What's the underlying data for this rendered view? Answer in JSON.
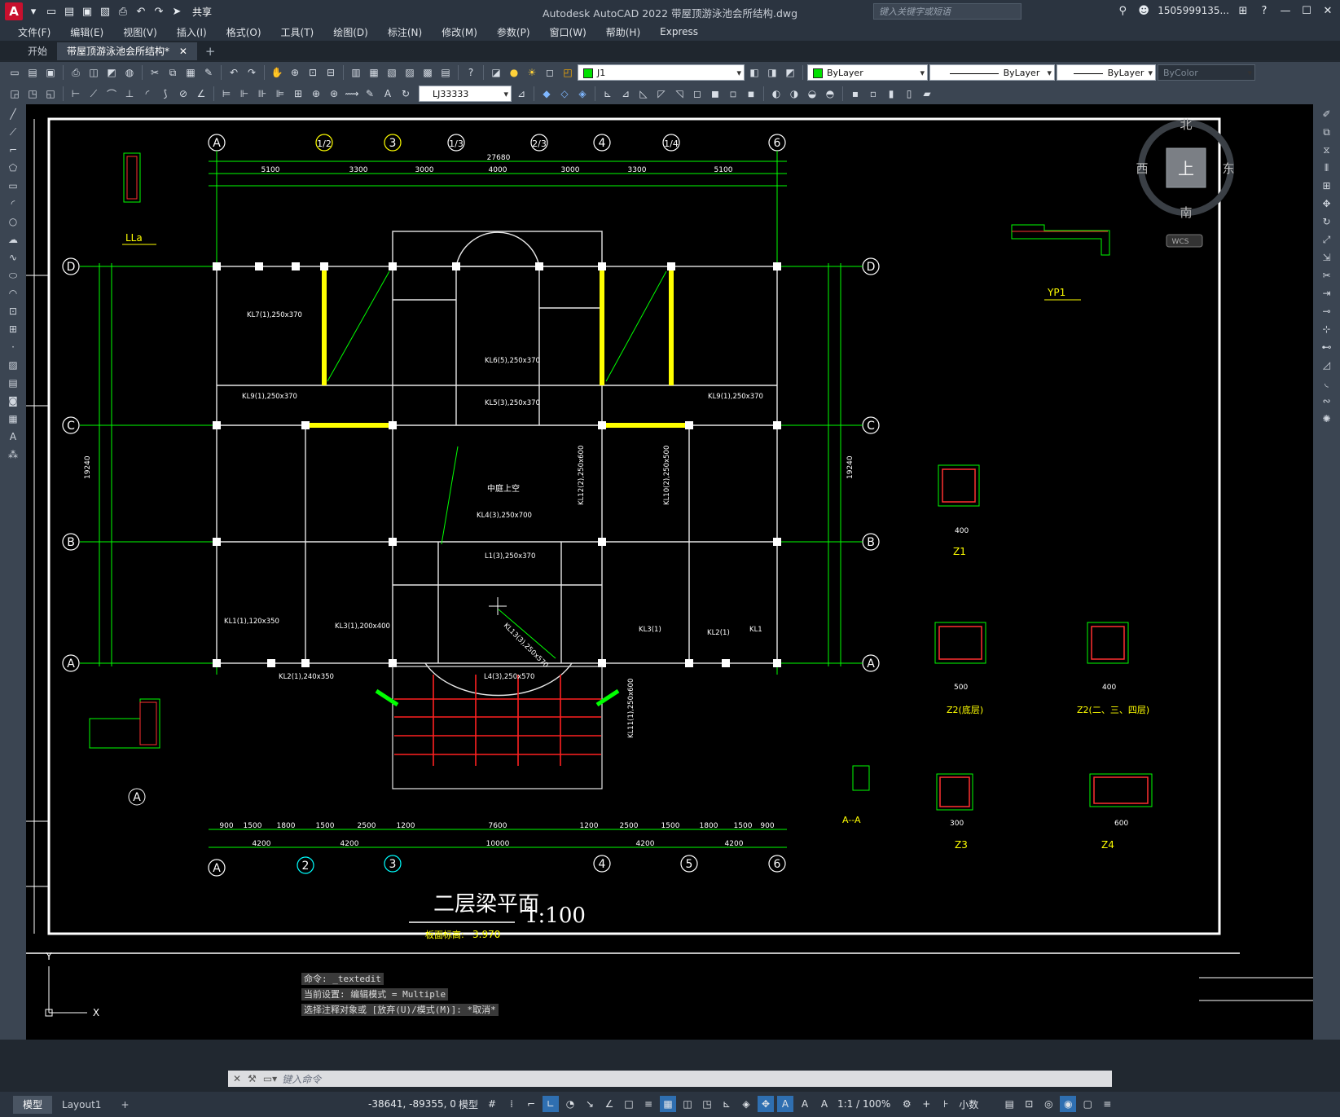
{
  "app": {
    "title": "Autodesk AutoCAD 2022    带屋顶游泳池会所结构.dwg",
    "share_label": "共享",
    "search_placeholder": "键入关键字或短语",
    "user": "1505999135...",
    "logo": "A"
  },
  "menu": [
    "文件(F)",
    "编辑(E)",
    "视图(V)",
    "插入(I)",
    "格式(O)",
    "工具(T)",
    "绘图(D)",
    "标注(N)",
    "修改(M)",
    "参数(P)",
    "窗口(W)",
    "帮助(H)",
    "Express"
  ],
  "tabs": [
    {
      "label": "开始",
      "active": false
    },
    {
      "label": "带屋顶游泳池会所结构*",
      "active": true
    }
  ],
  "toolbar": {
    "layer": "J1",
    "color": "ByLayer",
    "linetype": "ByLayer",
    "lineweight": "ByLayer",
    "plotstyle": "ByColor",
    "dimstyle": "LJ33333"
  },
  "viewcube": {
    "north": "北",
    "south": "南",
    "east": "东",
    "west": "西",
    "face": "上",
    "wcs": "WCS"
  },
  "drawing": {
    "title": "二层梁平面",
    "scale": "1:100",
    "note_label": "板面标高:",
    "note_value": "3.970",
    "total_width": "27680",
    "total_depth": "19240",
    "center_label": "中庭上空",
    "top_dims": [
      "5100",
      "3300",
      "3000",
      "4000",
      "3000",
      "3300",
      "5100"
    ],
    "top_axes": [
      "A",
      "1/2",
      "3",
      "1/3",
      "2/3",
      "4",
      "1/4",
      "6"
    ],
    "bottom_axes": [
      "A",
      "2",
      "3",
      "4",
      "5",
      "6"
    ],
    "side_axes": [
      "D",
      "C",
      "B",
      "A"
    ],
    "bottom_dims": [
      "4200",
      "4200",
      "10000",
      "4200",
      "4200"
    ],
    "bottom_dims2": [
      "900",
      "1500",
      "1800",
      "1500",
      "2500",
      "1200",
      "7600",
      "1200",
      "2500",
      "1500",
      "1800",
      "1500",
      "900"
    ],
    "beam_labels": [
      "KL7(1),250x370",
      "KL9(1),250x370",
      "KL6(5),250x370",
      "KL5(3),250x370",
      "KL4(3),250x700",
      "KL1(1),120x350",
      "KL3(1),200x400",
      "KL2(1),240x350",
      "L4(3),250x570",
      "L1(3),250x370",
      "KL13(3),250x570",
      "KL9(1),250x370",
      "KL3(1)",
      "KL2(1)",
      "KL1",
      "KL10(2),250x500",
      "KL12(2),250x600",
      "KL11(1),250x600"
    ],
    "details": [
      {
        "name": "LLa"
      },
      {
        "name": "YP1"
      },
      {
        "name": "Z1",
        "w": "400",
        "h": "400"
      },
      {
        "name": "Z2(底层)",
        "w": "500",
        "h": "400"
      },
      {
        "name": "Z2(二、三、四层)",
        "w": "400",
        "h": "400"
      },
      {
        "name": "A--A"
      },
      {
        "name": "Z3",
        "w": "300",
        "h": "300"
      },
      {
        "name": "Z4",
        "w": "600",
        "h": "250"
      }
    ]
  },
  "command": {
    "history": [
      "命令: _textedit",
      "当前设置: 编辑模式 = Multiple",
      "选择注释对象或 [放弃(U)/模式(M)]: *取消*"
    ],
    "placeholder": "键入命令"
  },
  "status": {
    "tabs": [
      "模型",
      "Layout1"
    ],
    "coords": "-38641, -89355, 0",
    "model": "模型",
    "scale": "1:1 / 100%",
    "units": "小数"
  }
}
